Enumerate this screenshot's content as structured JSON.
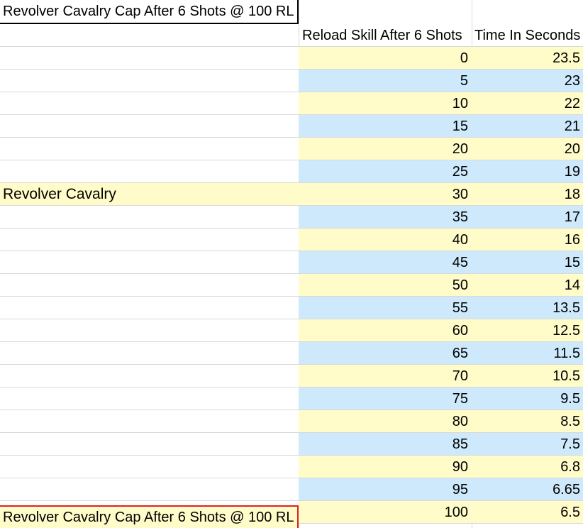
{
  "title": "Revolver Cavalry Cap After 6 Shots @ 100 RL",
  "headers": {
    "col_b": "Reload Skill After 6 Shots",
    "col_c": "Time In Seconds"
  },
  "group_label": "Revolver Cavalry",
  "footer_label": "Revolver Cavalry Cap After 6 Shots @ 100 RL",
  "colors": {
    "row_yellow": "#fffcc9",
    "row_blue": "#cde9fb",
    "title_border": "#000000",
    "footer_border": "#e02020"
  },
  "rows": [
    {
      "skill": "0",
      "time": "23.5"
    },
    {
      "skill": "5",
      "time": "23"
    },
    {
      "skill": "10",
      "time": "22"
    },
    {
      "skill": "15",
      "time": "21"
    },
    {
      "skill": "20",
      "time": "20"
    },
    {
      "skill": "25",
      "time": "19"
    },
    {
      "skill": "30",
      "time": "18"
    },
    {
      "skill": "35",
      "time": "17"
    },
    {
      "skill": "40",
      "time": "16"
    },
    {
      "skill": "45",
      "time": "15"
    },
    {
      "skill": "50",
      "time": "14"
    },
    {
      "skill": "55",
      "time": "13.5"
    },
    {
      "skill": "60",
      "time": "12.5"
    },
    {
      "skill": "65",
      "time": "11.5"
    },
    {
      "skill": "70",
      "time": "10.5"
    },
    {
      "skill": "75",
      "time": "9.5"
    },
    {
      "skill": "80",
      "time": "8.5"
    },
    {
      "skill": "85",
      "time": "7.5"
    },
    {
      "skill": "90",
      "time": "6.8"
    },
    {
      "skill": "95",
      "time": "6.65"
    },
    {
      "skill": "100",
      "time": "6.5"
    }
  ]
}
